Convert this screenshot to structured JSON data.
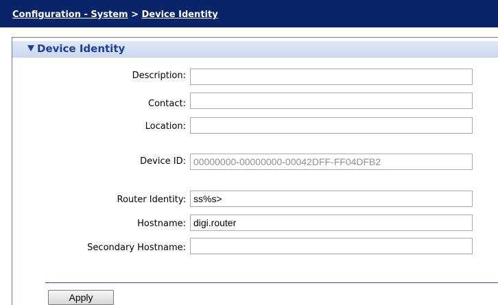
{
  "breadcrumb": {
    "parent": "Configuration - System",
    "separator": " > ",
    "current": "Device Identity"
  },
  "section": {
    "title": "Device Identity"
  },
  "form": {
    "description": {
      "label": "Description:",
      "value": ""
    },
    "contact": {
      "label": "Contact:",
      "value": ""
    },
    "location": {
      "label": "Location:",
      "value": ""
    },
    "device_id": {
      "label": "Device ID:",
      "value": "00000000-00000000-00042DFF-FF04DFB2"
    },
    "router_identity": {
      "label": "Router Identity:",
      "value": "ss%s>"
    },
    "hostname": {
      "label": "Hostname:",
      "value": "digi.router"
    },
    "secondary_hostname": {
      "label": "Secondary Hostname:",
      "value": ""
    }
  },
  "actions": {
    "apply_label": "Apply"
  },
  "colors": {
    "header_bg": "#0a246a",
    "section_header_bg": "#c9d7ef",
    "section_title": "#1b3f9a"
  }
}
